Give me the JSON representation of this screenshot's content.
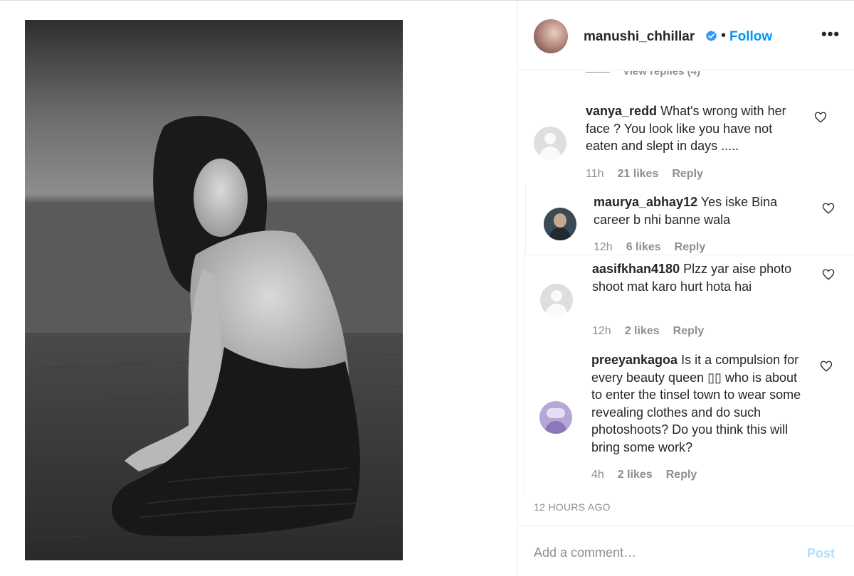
{
  "post": {
    "author": "manushi_chhillar",
    "follow_label": "Follow",
    "separator": "•",
    "more_label": "•••",
    "timestamp": "12 HOURS AGO",
    "photo_description": "black-and-white portrait photo"
  },
  "comments_section": {
    "view_replies": "View replies (4)",
    "items": [
      {
        "username": "vanya_redd",
        "text": "What's wrong with her face ? You look like you have not eaten and slept in days .....",
        "time": "11h",
        "likes": "21 likes",
        "reply": "Reply"
      },
      {
        "username": "maurya_abhay12",
        "text": "Yes iske Bina career b nhi banne wala",
        "time": "12h",
        "likes": "6 likes",
        "reply": "Reply"
      },
      {
        "username": "aasifkhan4180",
        "text": "Plzz yar aise photo shoot mat karo hurt hota hai",
        "time": "12h",
        "likes": "2 likes",
        "reply": "Reply"
      },
      {
        "username": "preeyankagoa",
        "text": "Is it a compulsion for every beauty queen ▯▯ who is about to enter the tinsel town to wear some revealing clothes and do such photoshoots? Do you think this will bring some work?",
        "time": "4h",
        "likes": "2 likes",
        "reply": "Reply"
      }
    ]
  },
  "composer": {
    "placeholder": "Add a comment…",
    "post_label": "Post"
  },
  "colors": {
    "accent": "#0095f6",
    "post_disabled": "#b2dffc",
    "muted": "#8e8e8e",
    "text": "#262626"
  },
  "icons": {
    "verified": "verified-badge-icon",
    "heart": "heart-outline-icon",
    "more": "more-options-icon"
  }
}
